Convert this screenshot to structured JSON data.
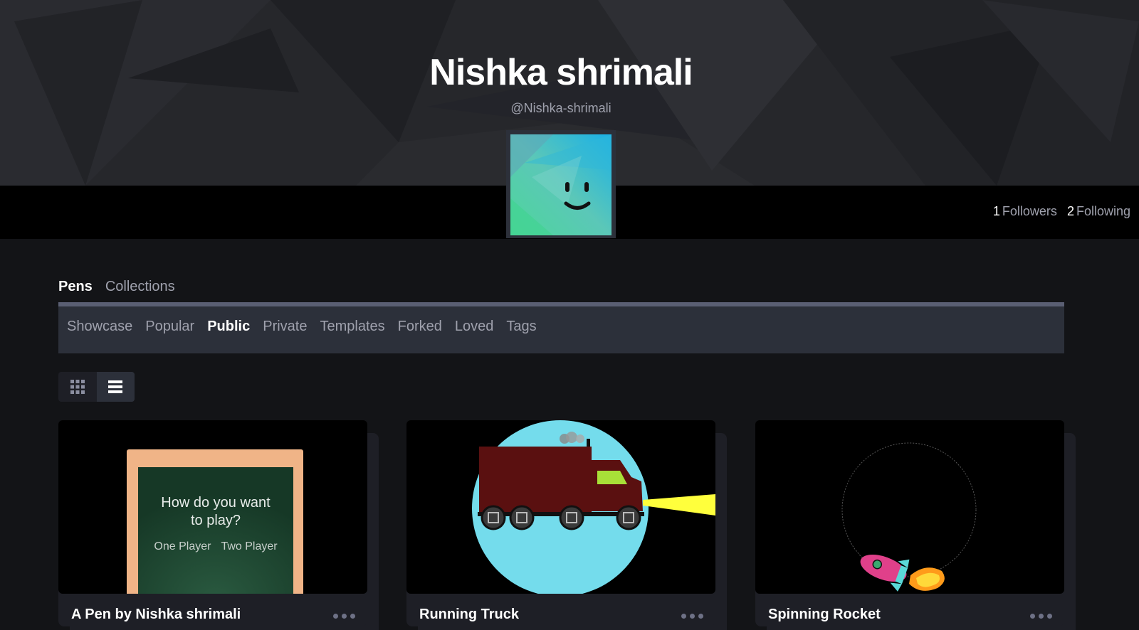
{
  "profile": {
    "name": "Nishka shrimali",
    "handle": "@Nishka-shrimali",
    "followers_count": "1",
    "followers_label": "Followers",
    "following_count": "2",
    "following_label": "Following"
  },
  "tabs": [
    {
      "label": "Pens",
      "active": true
    },
    {
      "label": "Collections",
      "active": false
    }
  ],
  "subnav": [
    {
      "label": "Showcase",
      "active": false
    },
    {
      "label": "Popular",
      "active": false
    },
    {
      "label": "Public",
      "active": true
    },
    {
      "label": "Private",
      "active": false
    },
    {
      "label": "Templates",
      "active": false
    },
    {
      "label": "Forked",
      "active": false
    },
    {
      "label": "Loved",
      "active": false
    },
    {
      "label": "Tags",
      "active": false
    }
  ],
  "view_toggle": {
    "grid_icon": "grid-icon",
    "list_icon": "list-icon",
    "active": "list"
  },
  "cards": [
    {
      "title": "A Pen by Nishka shrimali",
      "preview": {
        "question_line1": "How do you want",
        "question_line2": "to play?",
        "option1": "One Player",
        "option2": "Two Player"
      }
    },
    {
      "title": "Running Truck"
    },
    {
      "title": "Spinning Rocket"
    }
  ],
  "colors": {
    "background": "#131417",
    "hero": "#26272b",
    "panel": "#2c303a",
    "chalkboard": "#1f4a35",
    "board_frame": "#f0b487",
    "truck": "#5a1010",
    "sky_circle": "#74dcec"
  }
}
